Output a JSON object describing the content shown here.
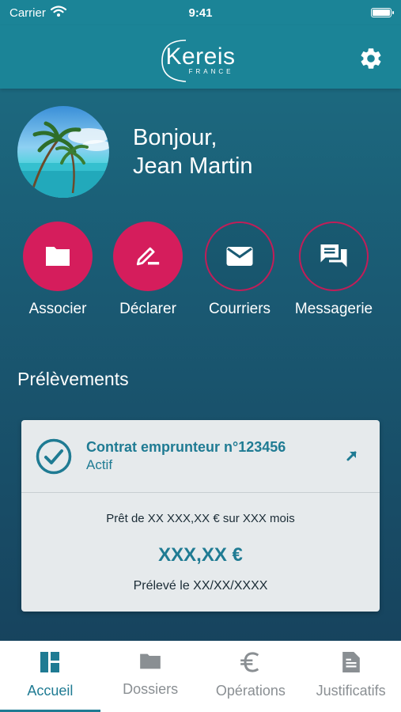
{
  "status_bar": {
    "carrier": "Carrier",
    "time": "9:41"
  },
  "header": {
    "logo_text": "Kereis",
    "logo_subtitle": "FRANCE",
    "settings_icon": "gear-icon"
  },
  "profile": {
    "greeting_line1": "Bonjour,",
    "greeting_line2": "Jean Martin"
  },
  "actions": [
    {
      "label": "Associer",
      "icon": "folder-icon",
      "style": "filled"
    },
    {
      "label": "Déclarer",
      "icon": "pen-icon",
      "style": "filled"
    },
    {
      "label": "Courriers",
      "icon": "mail-icon",
      "style": "outline"
    },
    {
      "label": "Messagerie",
      "icon": "chat-icon",
      "style": "outline"
    }
  ],
  "section": {
    "title": "Prélèvements"
  },
  "contract": {
    "title": "Contrat emprunteur n°123456",
    "status": "Actif",
    "description": "Prêt de XX XXX,XX € sur XXX mois",
    "amount": "XXX,XX €",
    "date": "Prélevé le XX/XX/XXXX"
  },
  "tabs": [
    {
      "label": "Accueil",
      "icon": "dashboard-icon",
      "active": true
    },
    {
      "label": "Dossiers",
      "icon": "folder-icon",
      "active": false
    },
    {
      "label": "Opérations",
      "icon": "euro-icon",
      "active": false
    },
    {
      "label": "Justificatifs",
      "icon": "document-icon",
      "active": false
    }
  ],
  "colors": {
    "accent": "#1f7b93",
    "header": "#1b8497",
    "action": "#d51d5c",
    "inactive_tab": "#8a8f93"
  }
}
